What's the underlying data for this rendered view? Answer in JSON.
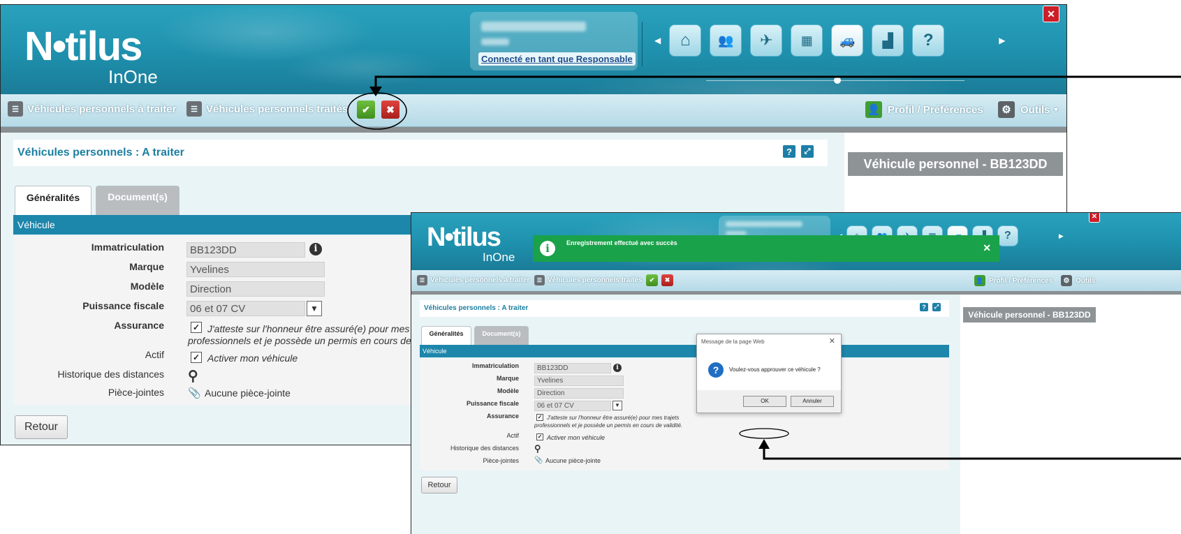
{
  "app": {
    "logo_text": "N•tilus",
    "logo_sub": "InOne",
    "user_link": "Connecté en tant que Responsable"
  },
  "toolbar": {
    "to_process": "Véhicules personnels à traiter",
    "processed": "Véhicules personnels traités",
    "profile": "Profil / Préférences",
    "tools": "Outils"
  },
  "page": {
    "title": "Véhicules personnels : A traiter",
    "tabs": [
      "Généralités",
      "Document(s)"
    ],
    "section": "Véhicule",
    "back_button": "Retour",
    "right_panel_title": "Véhicule personnel - BB123DD"
  },
  "form": {
    "immatriculation": {
      "label": "Immatriculation",
      "value": "BB123DD"
    },
    "marque": {
      "label": "Marque",
      "value": "Yvelines"
    },
    "modele": {
      "label": "Modèle",
      "value": "Direction"
    },
    "puissance": {
      "label": "Puissance fiscale",
      "value": "06 et 07 CV"
    },
    "assurance": {
      "label": "Assurance",
      "text_line1": "J'atteste sur l'honneur être assuré(e) pour mes trajets",
      "text_line2": "professionnels et je possède un permis en cours de validité."
    },
    "actif": {
      "label": "Actif",
      "text": "Activer mon véhicule"
    },
    "historique": {
      "label": "Historique des distances"
    },
    "pieces": {
      "label": "Pièce-jointes",
      "text": "Aucune pièce-jointe"
    }
  },
  "toast": {
    "message": "Enregistrement effectué avec succès"
  },
  "dialog": {
    "title": "Message de la page Web",
    "message": "Voulez-vous approuver ce véhicule ?",
    "ok": "OK",
    "cancel": "Annuler"
  },
  "icons": [
    "home-icon",
    "users-icon",
    "plane-icon",
    "stamp-icon",
    "car-icon",
    "chart-icon",
    "help-icon",
    "info-icon",
    "search-icon",
    "paperclip-icon",
    "gear-icon",
    "list-icon",
    "approve-icon",
    "reject-icon",
    "close-icon"
  ],
  "colors": {
    "brand_teal": "#1e90ad",
    "title_blue": "#1c7fa0",
    "success_green": "#1aa24a",
    "approve_green": "#3f8f1f",
    "reject_red": "#a8201c"
  }
}
